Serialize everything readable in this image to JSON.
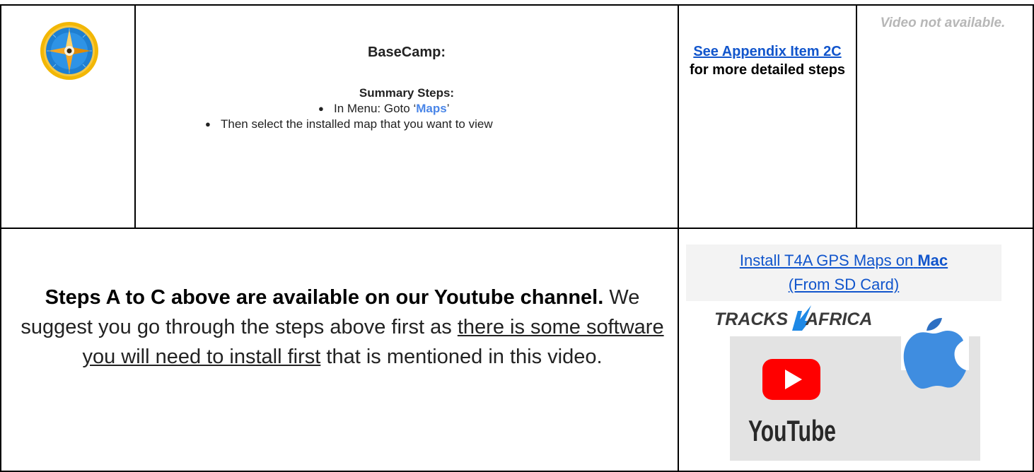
{
  "basecamp": {
    "title": "BaseCamp:",
    "summary_title": "Summary Steps:",
    "step1_prefix": "In Menu: Goto ‘",
    "step1_bold": "Maps",
    "step1_suffix": "’",
    "step2": "Then select the installed map that you want to view"
  },
  "appendix": {
    "link_text": "See Appendix Item 2C",
    "rest_text": "for more detailed steps"
  },
  "video_status": "Video not available.",
  "youtube_note": {
    "bold": "Steps A to C above are available on our Youtube channel.",
    "text1": "We suggest you go through the steps above first as",
    "underlined": "there is some software you will need to install first",
    "text2": "that is mentioned in this video."
  },
  "video_link": {
    "part1": "Install T4A GPS Maps on",
    "bold": "Mac",
    "part2": "(From SD Card)"
  },
  "thumbnail": {
    "brand_left": "TRACKS",
    "brand_right": "AFRICA",
    "youtube_word": "YouTube"
  },
  "icons": [
    "compass-icon",
    "apple-icon",
    "youtube-play-icon"
  ],
  "colors": {
    "link": "#1155cc",
    "maps_accent": "#4a86e8",
    "muted": "#b7b7b7",
    "youtube_red": "#ff0000"
  }
}
